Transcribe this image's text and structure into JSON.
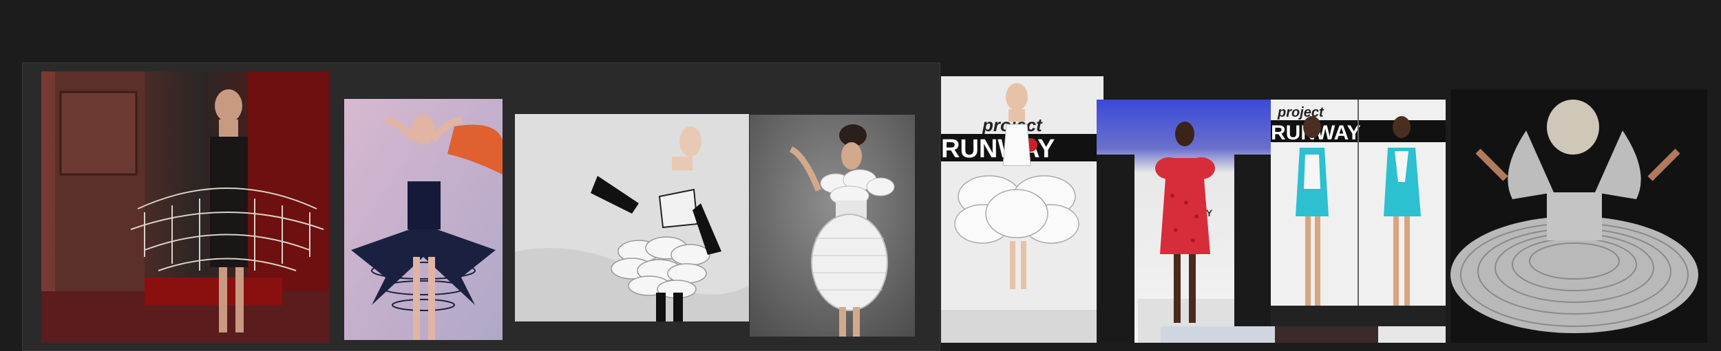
{
  "colors": {
    "page_bg": "#1c1c1c",
    "board_bg": "#2a2a2a"
  },
  "photos": [
    {
      "name": "photo-chandelier-dress",
      "subject": "model in chandelier crystal dress",
      "caption": ""
    },
    {
      "name": "photo-black-cage-dress",
      "subject": "model in black fan cage dress",
      "caption": ""
    },
    {
      "name": "photo-white-petal-dress",
      "subject": "model in white petal dress",
      "caption": ""
    },
    {
      "name": "photo-ruffle-bob-dress",
      "subject": "model in white ruffle bubble dress",
      "caption": ""
    },
    {
      "name": "photo-runway-white-dress",
      "subject": "runway white layered dress",
      "caption": "",
      "logo": "project RUNWAY"
    },
    {
      "name": "photo-runway-red-dress",
      "subject": "runway red textured dress",
      "caption": ""
    },
    {
      "name": "photo-runway-teal-dress",
      "subject": "runway teal dress front and back",
      "caption": "",
      "logo": "project RUNWAY"
    },
    {
      "name": "photo-ruffled-spin-dress",
      "subject": "model in ruffled spinning dress",
      "caption": ""
    }
  ]
}
